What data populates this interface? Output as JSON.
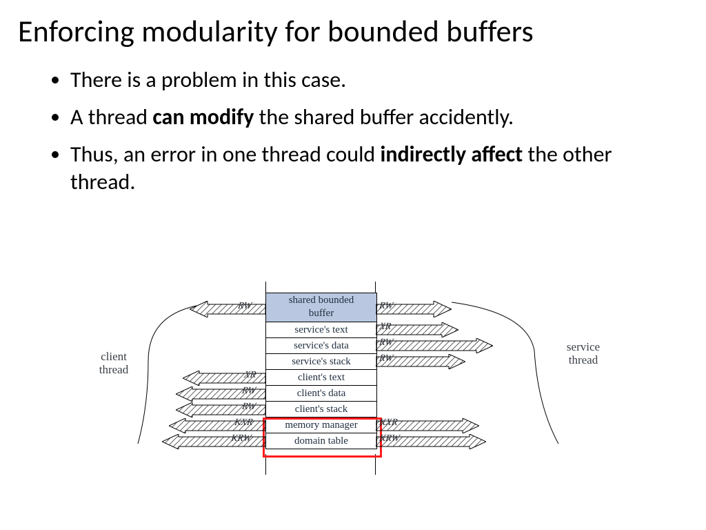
{
  "title": "Enforcing modularity for bounded buffers",
  "bullets": {
    "b1": "There is a problem in this case.",
    "b2_pre": "A thread ",
    "b2_bold": "can modify",
    "b2_post": " the shared buffer accidently.",
    "b3_pre": "Thus, an error in one thread could ",
    "b3_bold": "indirectly affect",
    "b3_post": " the other thread."
  },
  "labels": {
    "client_thread": "client\nthread",
    "service_thread": "service\nthread"
  },
  "rows": {
    "r0": "shared bounded\nbuffer",
    "r1": "service's text",
    "r2": "service's data",
    "r3": "service's stack",
    "r4": "client's text",
    "r5": "client's data",
    "r6": "client's stack",
    "r7": "memory manager",
    "r8": "domain table"
  },
  "perms": {
    "RW": "RW",
    "XR": "XR",
    "KXR": "KXR",
    "KRW": "KRW"
  }
}
